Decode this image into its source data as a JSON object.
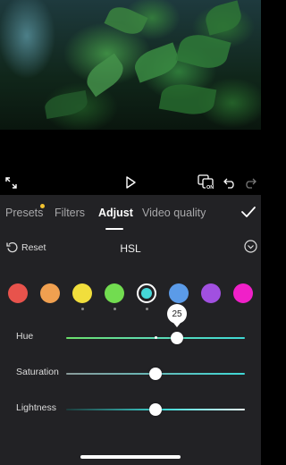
{
  "preview": {
    "description_icon": "leaf-image"
  },
  "toolbar": {
    "fullscreen_icon": "fullscreen-icon",
    "play_icon": "play-icon",
    "compare_badge": "ON",
    "undo_icon": "undo-icon",
    "redo_icon": "redo-icon"
  },
  "tabs": [
    {
      "label": "Presets",
      "has_dot": true
    },
    {
      "label": "Filters"
    },
    {
      "label": "Adjust",
      "active": true
    },
    {
      "label": "Video quality"
    }
  ],
  "confirm_icon": "check-icon",
  "hsl": {
    "reset_label": "Reset",
    "title": "HSL",
    "toggle_icon": "chevron-down-circle-icon"
  },
  "colors": {
    "swatches": [
      "#e8534c",
      "#f0a050",
      "#f1de3c",
      "#72dc50",
      "#45d7d8",
      "#5b9be8",
      "#a150e0",
      "#f020c8"
    ],
    "selected_index": 4,
    "accent": "#3fd9d6"
  },
  "sliders": [
    {
      "label": "Hue",
      "value": 25,
      "fraction": 0.62
    },
    {
      "label": "Saturation",
      "fraction": 0.5
    },
    {
      "label": "Lightness",
      "fraction": 0.5
    }
  ]
}
